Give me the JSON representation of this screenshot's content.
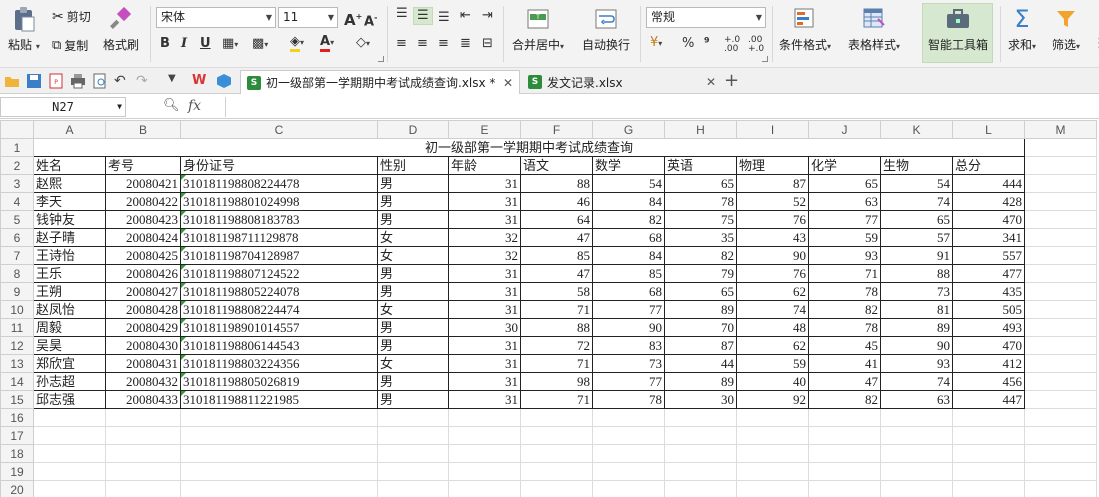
{
  "ribbon": {
    "paste": "粘贴",
    "cut": "剪切",
    "copy": "复制",
    "format_painter": "格式刷",
    "font_name": "宋体",
    "font_size": "11",
    "merge_center": "合并居中",
    "auto_wrap": "自动换行",
    "number_format": "常规",
    "percent": "%",
    "comma": "⁹",
    "dec_inc": "+.0 .00",
    "dec_dec": ".00 +.0",
    "conditional_format": "条件格式",
    "table_style": "表格样式",
    "smart_toolbox": "智能工具箱",
    "sum": "求和",
    "filter": "筛选"
  },
  "tabs": [
    {
      "label": "初一级部第一学期期中考试成绩查询.xlsx *"
    },
    {
      "label": "发文记录.xlsx"
    }
  ],
  "formula_bar": {
    "name_box": "N27",
    "fx": "fx"
  },
  "sheet": {
    "columns": [
      "A",
      "B",
      "C",
      "D",
      "E",
      "F",
      "G",
      "H",
      "I",
      "J",
      "K",
      "L",
      "M"
    ],
    "row_numbers": [
      "1",
      "2",
      "3",
      "4",
      "5",
      "6",
      "7",
      "8",
      "9",
      "10",
      "11",
      "12",
      "13",
      "14",
      "15",
      "16",
      "17",
      "18",
      "19",
      "20"
    ],
    "title": "初一级部第一学期期中考试成绩查询",
    "headers": [
      "姓名",
      "考号",
      "身份证号",
      "性别",
      "年龄",
      "语文",
      "数学",
      "英语",
      "物理",
      "化学",
      "生物",
      "总分"
    ],
    "rows": [
      [
        "赵熙",
        "20080421",
        "310181198808224478",
        "男",
        "31",
        "88",
        "54",
        "65",
        "87",
        "65",
        "54",
        "444"
      ],
      [
        "李天",
        "20080422",
        "310181198801024998",
        "男",
        "31",
        "46",
        "84",
        "78",
        "52",
        "63",
        "74",
        "428"
      ],
      [
        "钱钟友",
        "20080423",
        "310181198808183783",
        "男",
        "31",
        "64",
        "82",
        "75",
        "76",
        "77",
        "65",
        "470"
      ],
      [
        "赵子晴",
        "20080424",
        "310181198711129878",
        "女",
        "32",
        "47",
        "68",
        "35",
        "43",
        "59",
        "57",
        "341"
      ],
      [
        "王诗怡",
        "20080425",
        "310181198704128987",
        "女",
        "32",
        "85",
        "84",
        "82",
        "90",
        "93",
        "91",
        "557"
      ],
      [
        "王乐",
        "20080426",
        "310181198807124522",
        "男",
        "31",
        "47",
        "85",
        "79",
        "76",
        "71",
        "88",
        "477"
      ],
      [
        "王朔",
        "20080427",
        "310181198805224078",
        "男",
        "31",
        "58",
        "68",
        "65",
        "62",
        "78",
        "73",
        "435"
      ],
      [
        "赵凤怡",
        "20080428",
        "310181198808224474",
        "女",
        "31",
        "71",
        "77",
        "89",
        "74",
        "82",
        "81",
        "505"
      ],
      [
        "周毅",
        "20080429",
        "310181198901014557",
        "男",
        "30",
        "88",
        "90",
        "70",
        "48",
        "78",
        "89",
        "493"
      ],
      [
        "吴昊",
        "20080430",
        "310181198806144543",
        "男",
        "31",
        "72",
        "83",
        "87",
        "62",
        "45",
        "90",
        "470"
      ],
      [
        "郑欣宜",
        "20080431",
        "310181198803224356",
        "女",
        "31",
        "71",
        "73",
        "44",
        "59",
        "41",
        "93",
        "412"
      ],
      [
        "孙志超",
        "20080432",
        "310181198805026819",
        "男",
        "31",
        "98",
        "77",
        "89",
        "40",
        "47",
        "74",
        "456"
      ],
      [
        "邱志强",
        "20080433",
        "310181198811221985",
        "男",
        "31",
        "71",
        "78",
        "30",
        "92",
        "82",
        "63",
        "447"
      ]
    ]
  }
}
